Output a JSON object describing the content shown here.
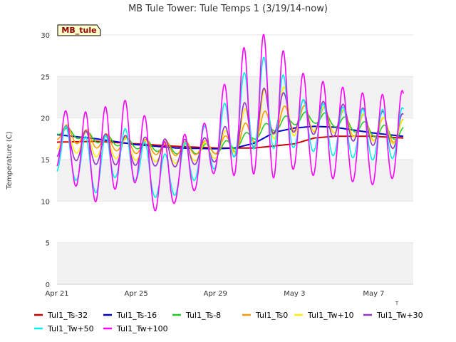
{
  "chart_data": {
    "type": "line",
    "title": "MB Tule Tower: Tule Temps 1 (3/19/14-now)",
    "xlabel": "",
    "ylabel": "Temperature (C)",
    "ylim": [
      0,
      30
    ],
    "y_ticks": [
      "0",
      "5",
      "10",
      "15",
      "20",
      "25",
      "30"
    ],
    "x_ticks": [
      {
        "label": "Apr 21",
        "day": 0
      },
      {
        "label": "Apr 25",
        "day": 4
      },
      {
        "label": "Apr 29",
        "day": 8
      },
      {
        "label": "May 3",
        "day": 12
      },
      {
        "label": "May 7",
        "day": 16
      }
    ],
    "xlim_days": [
      0,
      18
    ],
    "corner_tick": "T",
    "site_tag": "MB_tule",
    "grid": "horizontal bands",
    "legend_position": "bottom",
    "series": [
      {
        "name": "Tul1_Ts-32",
        "color": "#cc0000",
        "mode": "smooth",
        "points": [
          [
            0,
            17.1
          ],
          [
            2,
            17.2
          ],
          [
            4,
            16.9
          ],
          [
            6,
            16.6
          ],
          [
            8,
            16.4
          ],
          [
            10,
            16.4
          ],
          [
            12,
            16.9
          ],
          [
            13,
            17.6
          ],
          [
            14,
            17.8
          ],
          [
            16,
            17.8
          ],
          [
            17.5,
            17.6
          ]
        ]
      },
      {
        "name": "Tul1_Ts-16",
        "color": "#0000cc",
        "mode": "smooth",
        "points": [
          [
            0,
            18.0
          ],
          [
            2,
            17.5
          ],
          [
            4,
            16.8
          ],
          [
            6,
            16.4
          ],
          [
            8,
            16.3
          ],
          [
            9,
            16.4
          ],
          [
            10,
            17.0
          ],
          [
            11,
            18.3
          ],
          [
            12,
            18.8
          ],
          [
            13,
            19.0
          ],
          [
            14,
            18.9
          ],
          [
            16,
            18.2
          ],
          [
            17.5,
            17.8
          ]
        ]
      },
      {
        "name": "Tul1_Ts-8",
        "color": "#22cc22",
        "mode": "diurnal",
        "base": [
          [
            0,
            18.5
          ],
          [
            2,
            17.5
          ],
          [
            4,
            16.8
          ],
          [
            6,
            16.2
          ],
          [
            8,
            16.2
          ],
          [
            9,
            16.8
          ],
          [
            10,
            18.0
          ],
          [
            11,
            19.0
          ],
          [
            12,
            19.8
          ],
          [
            13,
            20.0
          ],
          [
            14,
            19.6
          ],
          [
            15,
            19.0
          ],
          [
            16,
            18.4
          ],
          [
            17.5,
            18.0
          ]
        ],
        "amp": [
          [
            0,
            0.5
          ],
          [
            18,
            0.8
          ]
        ],
        "phase": 0.55
      },
      {
        "name": "Tul1_Ts0",
        "color": "#ff9900",
        "mode": "diurnal",
        "base": [
          [
            0,
            18.3
          ],
          [
            2,
            17.2
          ],
          [
            4,
            16.5
          ],
          [
            6,
            16.2
          ],
          [
            8,
            16.4
          ],
          [
            9,
            17.0
          ],
          [
            10,
            18.5
          ],
          [
            11,
            19.5
          ],
          [
            12,
            19.8
          ],
          [
            14,
            19.5
          ],
          [
            16,
            18.5
          ],
          [
            17.5,
            18.2
          ]
        ],
        "amp": [
          [
            0,
            1.0
          ],
          [
            8,
            0.8
          ],
          [
            10,
            1.6
          ],
          [
            18,
            1.4
          ]
        ],
        "phase": 0.5
      },
      {
        "name": "Tul1_Tw+10",
        "color": "#ffee00",
        "mode": "diurnal",
        "base": [
          [
            0,
            17.5
          ],
          [
            2,
            16.5
          ],
          [
            4,
            16.0
          ],
          [
            6,
            15.5
          ],
          [
            8,
            16.0
          ],
          [
            9,
            17.5
          ],
          [
            10,
            19.0
          ],
          [
            11,
            20.5
          ],
          [
            12,
            20.0
          ],
          [
            14,
            19.5
          ],
          [
            16,
            18.5
          ],
          [
            17.5,
            18.0
          ]
        ],
        "amp": [
          [
            0,
            1.5
          ],
          [
            8,
            1.0
          ],
          [
            10,
            3.0
          ],
          [
            11,
            3.5
          ],
          [
            13,
            1.5
          ],
          [
            18,
            1.5
          ]
        ],
        "phase": 0.48
      },
      {
        "name": "Tul1_Tw+30",
        "color": "#9933cc",
        "mode": "diurnal",
        "base": [
          [
            0,
            17.0
          ],
          [
            2,
            16.0
          ],
          [
            4,
            15.8
          ],
          [
            6,
            15.5
          ],
          [
            8,
            16.0
          ],
          [
            9,
            17.5
          ],
          [
            10,
            19.5
          ],
          [
            11,
            20.5
          ],
          [
            12,
            20.0
          ],
          [
            14,
            19.5
          ],
          [
            16,
            18.5
          ],
          [
            17.5,
            18.0
          ]
        ],
        "amp": [
          [
            0,
            2.0
          ],
          [
            8,
            1.5
          ],
          [
            10,
            3.5
          ],
          [
            12,
            2.0
          ],
          [
            18,
            2.2
          ]
        ],
        "phase": 0.46
      },
      {
        "name": "Tul1_Tw+50",
        "color": "#00eeee",
        "mode": "diurnal",
        "base": [
          [
            0,
            16.0
          ],
          [
            1,
            15.0
          ],
          [
            2,
            13.5
          ],
          [
            3,
            15.5
          ],
          [
            4,
            15.0
          ],
          [
            5,
            12.5
          ],
          [
            6,
            13.0
          ],
          [
            7,
            15.0
          ],
          [
            8,
            16.5
          ],
          [
            9,
            19.0
          ],
          [
            10,
            21.0
          ],
          [
            11,
            21.0
          ],
          [
            12,
            19.0
          ],
          [
            14,
            18.0
          ],
          [
            16,
            17.5
          ],
          [
            17.5,
            17.8
          ]
        ],
        "amp": [
          [
            0,
            3.0
          ],
          [
            4,
            3.0
          ],
          [
            5,
            2.5
          ],
          [
            8,
            3.0
          ],
          [
            10,
            5.5
          ],
          [
            11,
            5.5
          ],
          [
            12,
            3.0
          ],
          [
            18,
            3.0
          ]
        ],
        "phase": 0.45
      },
      {
        "name": "Tul1_Tw+100",
        "color": "#ff00ff",
        "mode": "diurnal",
        "base": [
          [
            0,
            17.0
          ],
          [
            1,
            15.5
          ],
          [
            2,
            14.5
          ],
          [
            3,
            16.0
          ],
          [
            4,
            16.5
          ],
          [
            5,
            12.5
          ],
          [
            5.8,
            12.5
          ],
          [
            6.5,
            14.0
          ],
          [
            7.5,
            15.0
          ],
          [
            8,
            17.0
          ],
          [
            9,
            19.0
          ],
          [
            10,
            20.5
          ],
          [
            11,
            20.0
          ],
          [
            12,
            19.0
          ],
          [
            13,
            18.0
          ],
          [
            14,
            17.5
          ],
          [
            16,
            16.5
          ],
          [
            17.5,
            17.5
          ]
        ],
        "amp": [
          [
            0,
            3.5
          ],
          [
            2,
            5.5
          ],
          [
            4,
            5.0
          ],
          [
            5,
            4.5
          ],
          [
            6,
            3.5
          ],
          [
            8,
            4.0
          ],
          [
            9,
            7.0
          ],
          [
            10,
            8.5
          ],
          [
            11,
            8.5
          ],
          [
            12,
            6.0
          ],
          [
            18,
            5.0
          ]
        ],
        "phase": 0.44
      }
    ]
  }
}
